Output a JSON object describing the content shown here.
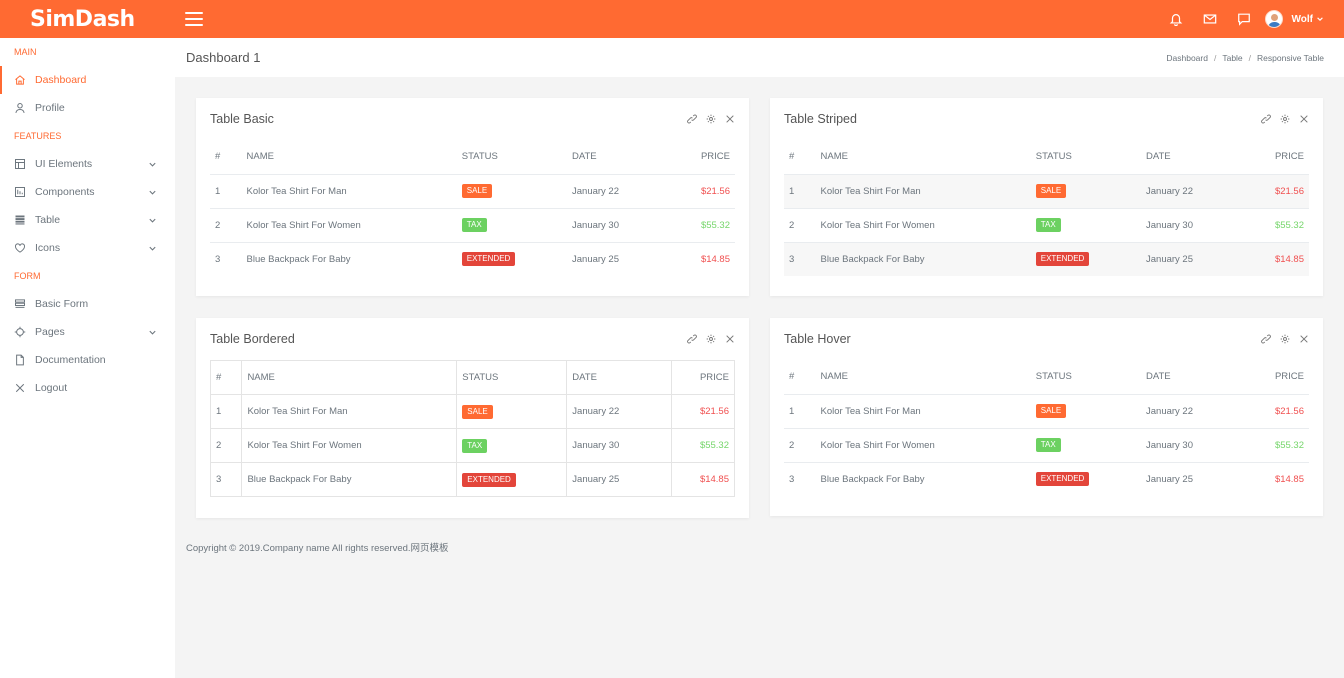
{
  "app": {
    "logo": "SimDash",
    "user_name": "Wolf"
  },
  "header": {
    "page_title": "Dashboard 1",
    "breadcrumb": [
      "Dashboard",
      "Table",
      "Responsive Table"
    ]
  },
  "sidebar": {
    "sections": [
      {
        "title": "MAIN",
        "items": [
          {
            "label": "Dashboard",
            "icon": "home-icon",
            "active": true,
            "expandable": false
          },
          {
            "label": "Profile",
            "icon": "user-icon",
            "active": false,
            "expandable": false
          }
        ]
      },
      {
        "title": "FEATURES",
        "items": [
          {
            "label": "UI Elements",
            "icon": "layout-icon",
            "active": false,
            "expandable": true
          },
          {
            "label": "Components",
            "icon": "components-icon",
            "active": false,
            "expandable": true
          },
          {
            "label": "Table",
            "icon": "table-icon",
            "active": false,
            "expandable": true
          },
          {
            "label": "Icons",
            "icon": "heart-icon",
            "active": false,
            "expandable": true
          }
        ]
      },
      {
        "title": "FORM",
        "items": [
          {
            "label": "Basic Form",
            "icon": "form-icon",
            "active": false,
            "expandable": false
          },
          {
            "label": "Pages",
            "icon": "target-icon",
            "active": false,
            "expandable": true
          },
          {
            "label": "Documentation",
            "icon": "document-icon",
            "active": false,
            "expandable": false
          },
          {
            "label": "Logout",
            "icon": "close-icon",
            "active": false,
            "expandable": false
          }
        ]
      }
    ]
  },
  "table_columns": [
    "#",
    "NAME",
    "STATUS",
    "DATE",
    "PRICE"
  ],
  "table_rows": [
    {
      "num": "1",
      "name": "Kolor Tea Shirt For Man",
      "status": "SALE",
      "status_kind": "sale",
      "date": "January 22",
      "price": "$21.56",
      "price_color": "red"
    },
    {
      "num": "2",
      "name": "Kolor Tea Shirt For Women",
      "status": "TAX",
      "status_kind": "tax",
      "date": "January 30",
      "price": "$55.32",
      "price_color": "green"
    },
    {
      "num": "3",
      "name": "Blue Backpack For Baby",
      "status": "EXTENDED",
      "status_kind": "ext",
      "date": "January 25",
      "price": "$14.85",
      "price_color": "red"
    }
  ],
  "cards": [
    {
      "title": "Table Basic",
      "style": "basic"
    },
    {
      "title": "Table Striped",
      "style": "striped"
    },
    {
      "title": "Table Bordered",
      "style": "bordered"
    },
    {
      "title": "Table Hover",
      "style": "hover"
    }
  ],
  "footer": {
    "text": "Copyright © 2019.Company name All rights reserved.网页模板"
  },
  "colors": {
    "accent": "#ff6a32",
    "sale": "#ff6a32",
    "tax": "#6cd161",
    "extended": "#e3453a",
    "price_red": "#f05050",
    "price_green": "#76d66b"
  }
}
